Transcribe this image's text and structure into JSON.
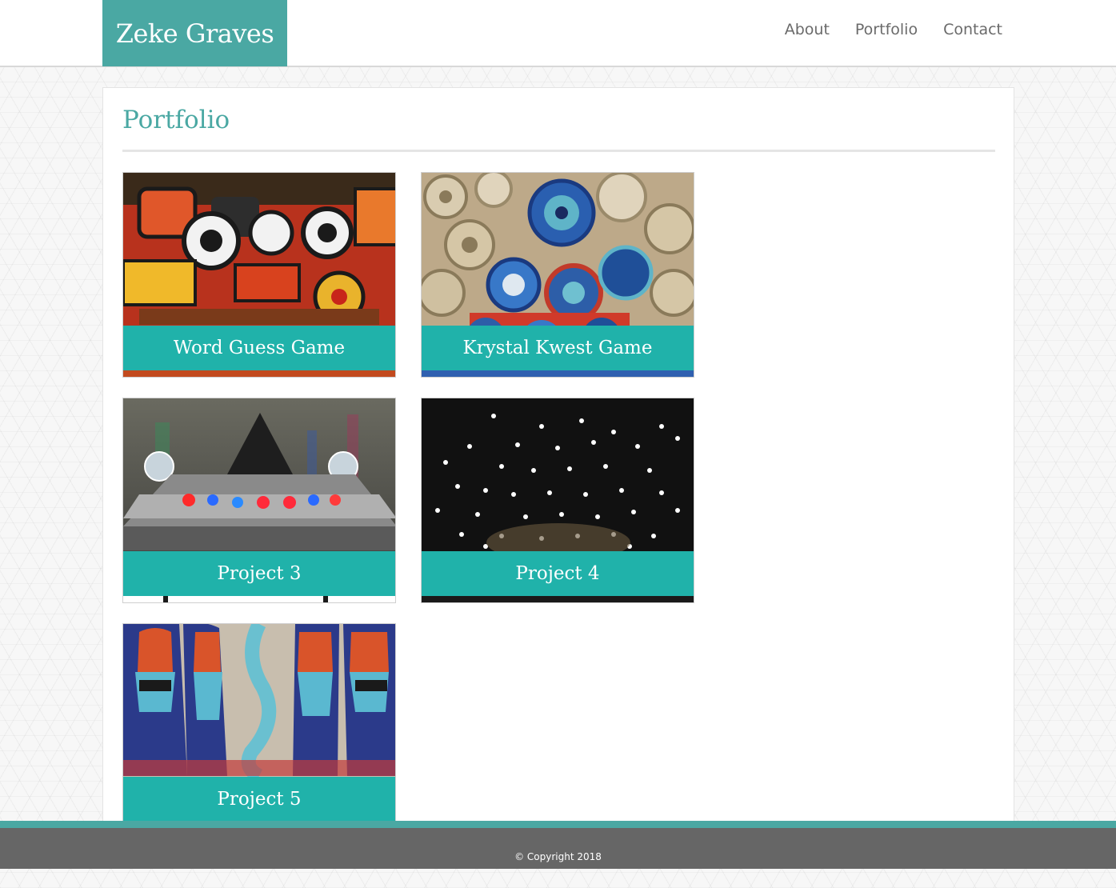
{
  "header": {
    "brand": "Zeke Graves",
    "nav": [
      {
        "label": "About"
      },
      {
        "label": "Portfolio"
      },
      {
        "label": "Contact"
      }
    ]
  },
  "main": {
    "title": "Portfolio",
    "projects": [
      {
        "title": "Word Guess Game"
      },
      {
        "title": "Krystal Kwest Game"
      },
      {
        "title": "Project 3"
      },
      {
        "title": "Project 4"
      },
      {
        "title": "Project 5"
      }
    ]
  },
  "footer": {
    "copyright": "© Copyright 2018"
  },
  "colors": {
    "brand": "#4aa8a3",
    "caption": "#20b2aa",
    "footer": "#666666"
  }
}
